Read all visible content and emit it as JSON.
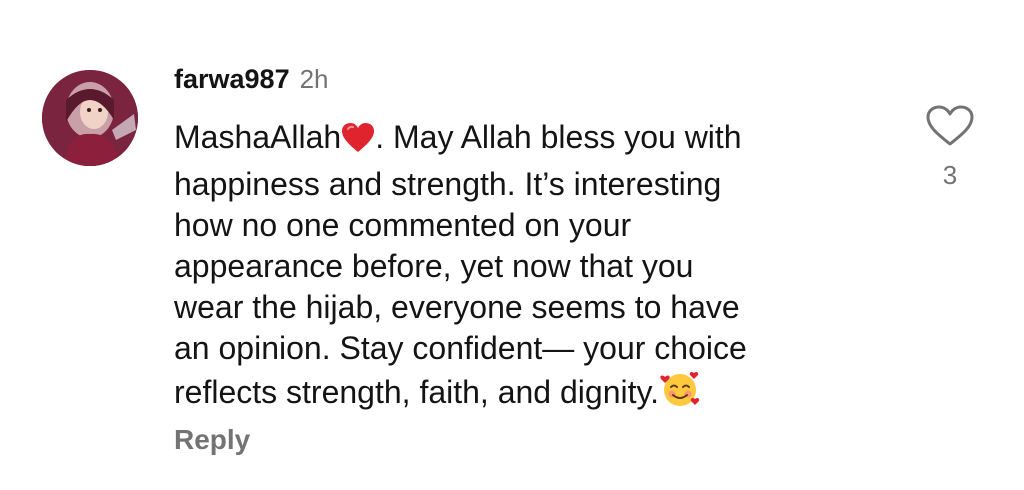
{
  "comment": {
    "username": "farwa987",
    "timestamp": "2h",
    "avatar_icon": "profile-avatar",
    "text_lines": [
      "MashaAllah",
      ". May Allah bless you with",
      "happiness and strength. It’s interesting",
      "how no one commented on your",
      "appearance before, yet now that you",
      "wear the hijab, everyone seems to have",
      "an opinion. Stay confident— your choice",
      "reflects strength, faith, and dignity."
    ],
    "emojis": [
      "red-heart-emoji",
      "smiling-face-with-hearts-emoji"
    ],
    "reply_label": "Reply",
    "like_icon": "heart-outline-icon",
    "like_count": "3"
  },
  "colors": {
    "text_primary": "#141414",
    "text_secondary": "#737373",
    "heart_red": "#e0242e",
    "background": "#ffffff"
  }
}
